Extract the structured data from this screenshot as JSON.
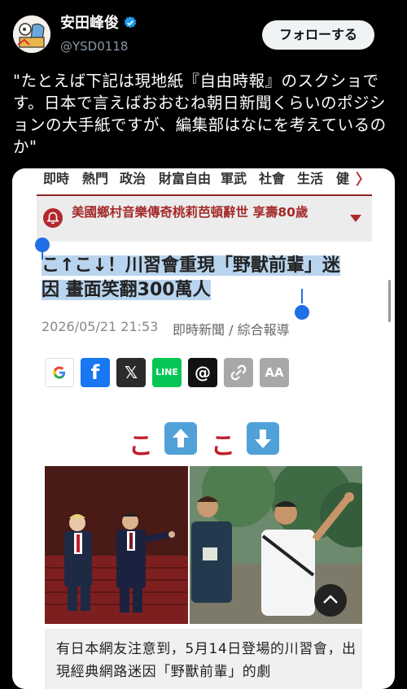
{
  "author": {
    "name": "安田峰俊",
    "handle": "@YSD0118",
    "follow_label": "フォローする"
  },
  "post": {
    "text": "\"たとえば下記は現地紙『自由時報』のスクショです。日本で言えばおおむね朝日新聞くらいのポジションの大手紙ですが、編集部はなにを考えているのか\""
  },
  "embed": {
    "nav": [
      "即時",
      "熱門",
      "政治",
      "財富自由",
      "軍武",
      "社會",
      "生活",
      "健"
    ],
    "nav_more": "〉",
    "banner": "美國鄉村音樂傳奇桃莉芭頓辭世 享壽80歲",
    "headline": "こ↑こ↓！川習會重現「野獸前輩」迷因 畫面笑翻300萬人",
    "date": "2026/05/21 21:53",
    "source": "即時新聞 / 綜合報導",
    "share": [
      {
        "name": "google-share-button",
        "label": "G",
        "color": "#ffffff"
      },
      {
        "name": "facebook-share-button",
        "label": "f",
        "color": "#1877f2"
      },
      {
        "name": "x-share-button",
        "label": "𝕏",
        "color": "#2b2b2b"
      },
      {
        "name": "line-share-button",
        "label": "LINE",
        "color": "#06c755"
      },
      {
        "name": "threads-share-button",
        "label": "@",
        "color": "#111111"
      },
      {
        "name": "copy-link-button",
        "label": "🔗",
        "color": "#a8a8a8"
      },
      {
        "name": "font-size-button",
        "label": "AA",
        "color": "#a8a8a8"
      }
    ],
    "emoji_title": {
      "char1": "こ",
      "char2": "こ"
    },
    "caption": "有日本網友注意到，5月14日登場的川習會，出現經典網路迷因「野獸前輩」的劇"
  },
  "colors": {
    "accent_red": "#b3282d",
    "selection": "#1f6fe5",
    "verified": "#1d9bf0"
  }
}
